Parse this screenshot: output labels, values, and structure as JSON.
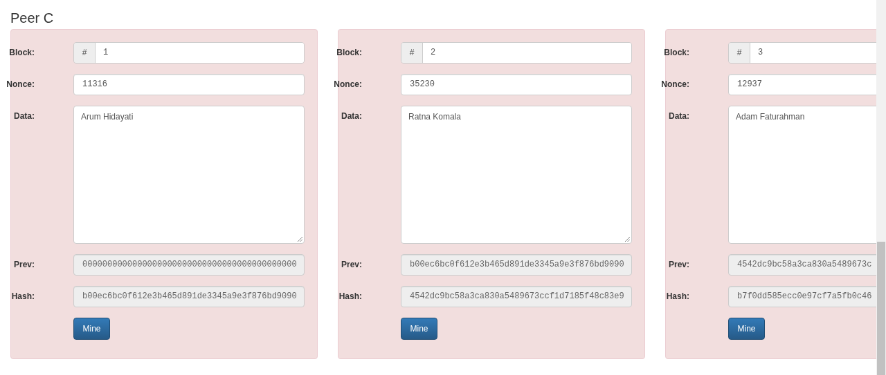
{
  "title": "Peer C",
  "blocks": [
    {
      "block_label": "Block:",
      "block_prefix": "#",
      "block": "1",
      "nonce_label": "Nonce:",
      "nonce": "11316",
      "data_label": "Data:",
      "data": "Arum Hidayati",
      "prev_label": "Prev:",
      "prev": "0000000000000000000000000000000000000000000",
      "hash_label": "Hash:",
      "hash": "b00ec6bc0f612e3b465d891de3345a9e3f876bd9090",
      "button": "Mine"
    },
    {
      "block_label": "Block:",
      "block_prefix": "#",
      "block": "2",
      "nonce_label": "Nonce:",
      "nonce": "35230",
      "data_label": "Data:",
      "data": "Ratna Komala",
      "prev_label": "Prev:",
      "prev": "b00ec6bc0f612e3b465d891de3345a9e3f876bd9090",
      "hash_label": "Hash:",
      "hash": "4542dc9bc58a3ca830a5489673ccf1d7185f48c83e9",
      "button": "Mine"
    },
    {
      "block_label": "Block:",
      "block_prefix": "#",
      "block": "3",
      "nonce_label": "Nonce:",
      "nonce": "12937",
      "data_label": "Data:",
      "data": "Adam Faturahman",
      "prev_label": "Prev:",
      "prev": "4542dc9bc58a3ca830a5489673c",
      "hash_label": "Hash:",
      "hash": "b7f0dd585ecc0e97cf7a5fb0c46",
      "button": "Mine"
    }
  ]
}
